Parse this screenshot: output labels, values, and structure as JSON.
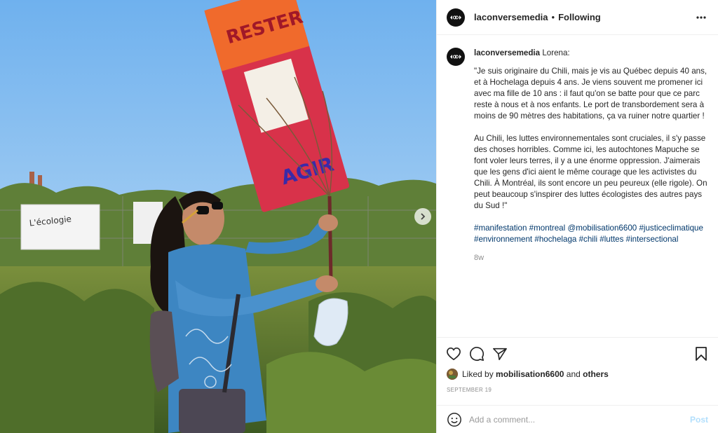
{
  "post": {
    "username": "laconversemedia",
    "follow_status": "Following",
    "more_icon": "more-horizontal-icon",
    "caption": {
      "author": "laconversemedia",
      "first_line": "Lorena:",
      "para1": "\"Je suis originaire du Chili, mais je vis au Québec depuis 40 ans, et à Hochelaga depuis 4 ans. Je viens souvent me promener ici avec ma fille de 10 ans : il faut qu'on se batte pour que ce parc reste à nous et à nos enfants. Le port de transbordement sera à moins de 90 mètres des habitations, ça va ruiner notre quartier !",
      "para2": "Au Chili, les luttes environnementales sont cruciales, il s'y passe des choses horribles. Comme ici, les autochtones Mapuche se font voler leurs terres, il y a une énorme oppression. J'aimerais que les gens d'ici aient le même courage que les activistes du Chili. À Montréal, ils sont encore un peu peureux (elle rigole). On peut beaucoup s'inspirer des luttes écologistes des autres pays du Sud !\"",
      "hashtags": [
        "#manifestation",
        "#montreal",
        "@mobilisation6600",
        "#justiceclimatique",
        "#environnement",
        "#hochelaga",
        "#chili",
        "#luttes",
        "#intersectional"
      ],
      "time_ago": "8w"
    },
    "likes": {
      "prefix": "Liked by",
      "user": "mobilisation6600",
      "connector": "and",
      "others": "others"
    },
    "date": "SEPTEMBER 19",
    "comment": {
      "placeholder": "Add a comment...",
      "post_label": "Post"
    },
    "photo": {
      "sign_text_top": "RESTER",
      "sign_text_bottom": "AGIR",
      "banner_text": "L'écologie"
    }
  },
  "colors": {
    "link": "#00376b",
    "muted": "#8e8e8e",
    "post_disabled": "#b2dffc",
    "sky": "#8fc2ef",
    "sign_red": "#d8324a",
    "sign_orange": "#f06a2c",
    "shirt_blue": "#3d86c2"
  }
}
